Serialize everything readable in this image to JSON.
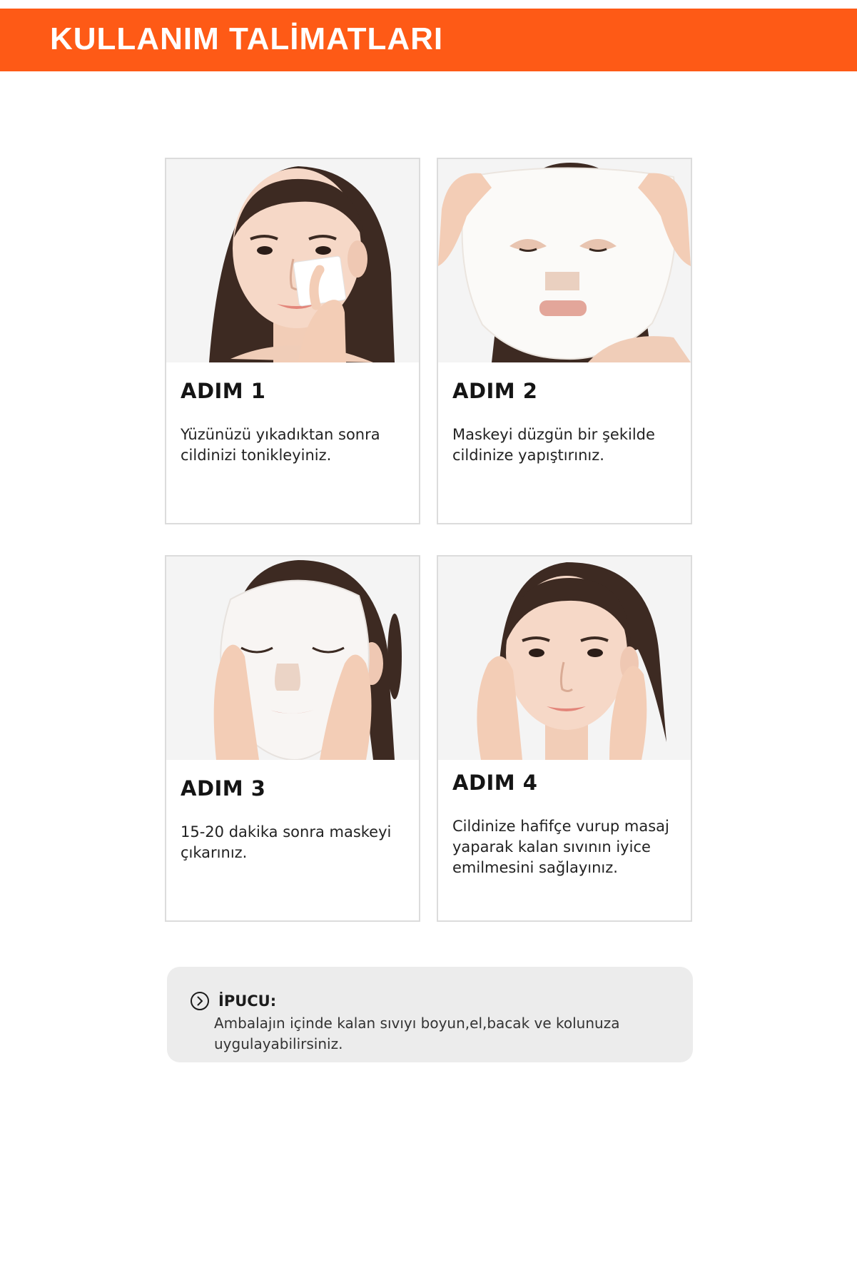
{
  "header": {
    "title": "KULLANIM TALİMATLARI"
  },
  "steps": [
    {
      "title": "ADIM 1",
      "text": "Yüzünüzü yıkadıktan sonra cildinizi tonikleyiniz."
    },
    {
      "title": "ADIM 2",
      "text": "Maskeyi düzgün bir şekilde cildinize yapıştırınız."
    },
    {
      "title": "ADIM 3",
      "text": "15-20 dakika sonra maskeyi çıkarınız."
    },
    {
      "title": "ADIM 4",
      "text": "Cildinize hafifçe vurup masaj yaparak  kalan sıvının iyice emilmesini sağlayınız."
    }
  ],
  "tip": {
    "label": "İPUCU:",
    "text": "Ambalajın içinde kalan sıvıyı boyun,el,bacak ve kolunuza uygulayabilirsiniz.",
    "icon": "chevron-right-circle-icon"
  },
  "colors": {
    "accent": "#fe5a16",
    "tip_background": "#ececec",
    "card_border": "#dcdcdc"
  }
}
